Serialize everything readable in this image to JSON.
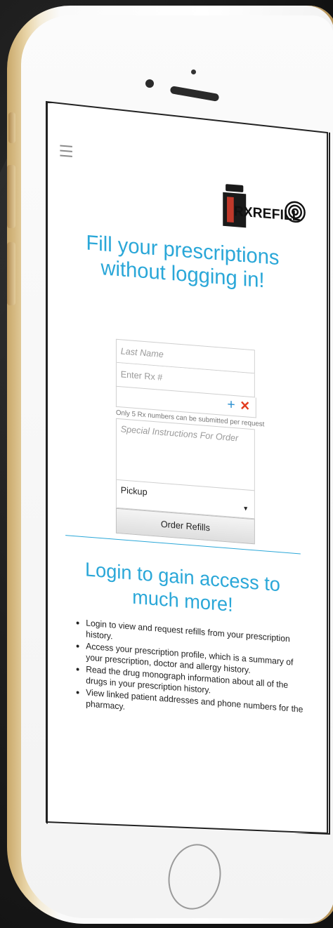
{
  "app": {
    "logo_text": "RXREFILL"
  },
  "hero": {
    "title": "Fill your prescriptions without logging in!"
  },
  "form": {
    "last_name_placeholder": "Last Name",
    "rx_placeholder": "Enter Rx #",
    "add_icon": "plus-icon",
    "remove_icon": "x-icon",
    "note": "Only 5 Rx numbers can be submitted per request",
    "instructions_placeholder": "Special Instructions For Order",
    "delivery_selected": "Pickup",
    "submit_label": "Order Refills"
  },
  "login_section": {
    "title": "Login to gain access to much more!",
    "benefits": [
      "Login to view and request refills from your prescription history.",
      "Access your prescription profile, which is a summary of your prescription, doctor and allergy history.",
      "Read the drug monograph information about all of the drugs in your prescription history.",
      "View linked patient addresses and phone numbers for the pharmacy."
    ]
  },
  "colors": {
    "accent": "#2aa7d8",
    "remove": "#e23a1d",
    "add": "#2a8fd0",
    "phone_gold": "#c9a86a"
  }
}
